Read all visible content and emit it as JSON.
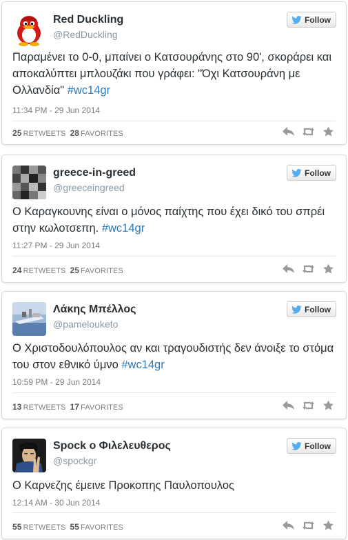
{
  "follow_label": "Follow",
  "colors": {
    "hashtag": "#2b7bb9",
    "name": "#292f33",
    "meta": "#7d7d7d"
  },
  "icons": [
    "twitter-bird-icon",
    "reply-icon",
    "retweet-icon",
    "favorite-star-icon"
  ],
  "tweets": [
    {
      "name": "Red Duckling",
      "handle": "@RedDuckling",
      "text_before": "Παραμένει το 0-0, μπαίνει ο Κατσουράνης στο 90', σκοράρει και αποκαλύπτει μπλουζάκι που γράφει: \"Όχι Κατσουράνη με Ολλανδία\" ",
      "hashtag": "#wc14gr",
      "text_after": "",
      "time": "11:34 PM - 29 Jun 2014",
      "retweets": "25",
      "retweets_label": "RETWEETS",
      "favorites": "28",
      "favorites_label": "FAVORITES"
    },
    {
      "name": "greece-in-greed",
      "handle": "@greeceingreed",
      "text_before": "Ο Καραγκουνης είναι ο μόνος παίχτης που  έχει δικό του σπρέι στην κωλοτσεπη. ",
      "hashtag": "#wc14gr",
      "text_after": "",
      "time": "11:27 PM - 29 Jun 2014",
      "retweets": "24",
      "retweets_label": "RETWEETS",
      "favorites": "25",
      "favorites_label": "FAVORITES"
    },
    {
      "name": "Λάκης Μπέλλος",
      "handle": "@pamelouketo",
      "text_before": "Ο Χριστοδουλόπουλος αν και τραγουδιστής δεν άνοιξε το στόμα του στον εθνικό ύμνο ",
      "hashtag": "#wc14gr",
      "text_after": "",
      "time": "10:59 PM - 29 Jun 2014",
      "retweets": "13",
      "retweets_label": "RETWEETS",
      "favorites": "17",
      "favorites_label": "FAVORITES"
    },
    {
      "name": "Spock ο Φιλελευθερος",
      "handle": "@spockgr",
      "text_before": "Ο Καρνεζης  έμεινε Προκοπης Παυλοπουλος",
      "hashtag": "",
      "text_after": "",
      "time": "12:14 AM - 30 Jun 2014",
      "retweets": "55",
      "retweets_label": "RETWEETS",
      "favorites": "55",
      "favorites_label": "FAVORITES"
    }
  ]
}
